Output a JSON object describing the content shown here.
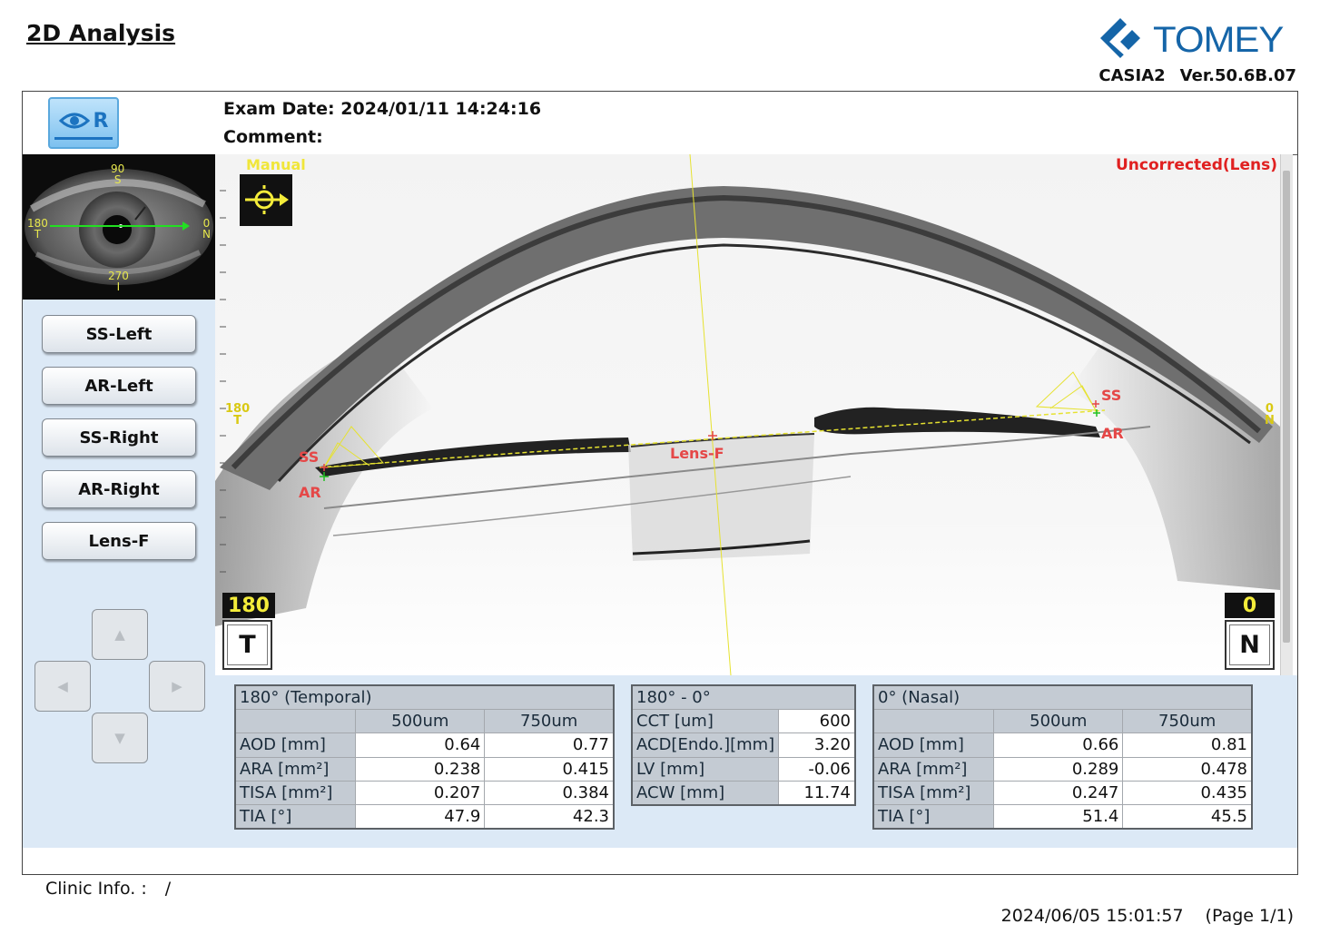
{
  "page": {
    "title": "2D Analysis",
    "brand": "TOMEY",
    "device": "CASIA2",
    "version": "Ver.50.6B.07"
  },
  "exam": {
    "eye": "R",
    "date_label": "Exam Date:",
    "date_value": "2024/01/11 14:24:16",
    "comment_label": "Comment:",
    "comment_value": ""
  },
  "fundus": {
    "top_angle": "90",
    "top_dir": "S",
    "left_angle": "180",
    "left_dir": "T",
    "right_angle": "0",
    "right_dir": "N",
    "bottom_angle": "270",
    "bottom_dir": "I"
  },
  "sidebar": {
    "buttons": [
      "SS-Left",
      "AR-Left",
      "SS-Right",
      "AR-Right",
      "Lens-F"
    ],
    "arrows": {
      "up": "▲",
      "left": "◀",
      "right": "▶",
      "down": "▼"
    }
  },
  "scan": {
    "mode_label": "Manual",
    "correction_label": "Uncorrected(Lens)",
    "left_ss": "SS",
    "left_ar": "AR",
    "right_ss": "SS",
    "right_ar": "AR",
    "lens_label": "Lens-F",
    "left_edge_angle": "180",
    "left_edge_dir": "T",
    "right_edge_angle": "0",
    "right_edge_dir": "N",
    "left_angle_box": "180",
    "left_dir_box": "T",
    "right_angle_box": "0",
    "right_dir_box": "N"
  },
  "tables": {
    "temporal": {
      "title": "180° (Temporal)",
      "cols": [
        "500um",
        "750um"
      ],
      "rows": [
        {
          "label": "AOD [mm]",
          "v500": "0.64",
          "v750": "0.77"
        },
        {
          "label": "ARA [mm²]",
          "v500": "0.238",
          "v750": "0.415"
        },
        {
          "label": "TISA [mm²]",
          "v500": "0.207",
          "v750": "0.384"
        },
        {
          "label": "TIA [°]",
          "v500": "47.9",
          "v750": "42.3"
        }
      ]
    },
    "center": {
      "title": "180° - 0°",
      "rows": [
        {
          "label": "CCT [um]",
          "value": "600"
        },
        {
          "label": "ACD[Endo.][mm]",
          "value": "3.20"
        },
        {
          "label": "LV [mm]",
          "value": "-0.06"
        },
        {
          "label": "ACW [mm]",
          "value": "11.74"
        }
      ]
    },
    "nasal": {
      "title": "0° (Nasal)",
      "cols": [
        "500um",
        "750um"
      ],
      "rows": [
        {
          "label": "AOD [mm]",
          "v500": "0.66",
          "v750": "0.81"
        },
        {
          "label": "ARA [mm²]",
          "v500": "0.289",
          "v750": "0.478"
        },
        {
          "label": "TISA [mm²]",
          "v500": "0.247",
          "v750": "0.435"
        },
        {
          "label": "TIA [°]",
          "v500": "51.4",
          "v750": "45.5"
        }
      ]
    }
  },
  "footer": {
    "clinic_label": "Clinic Info. :",
    "clinic_value": "/",
    "printed": "2024/06/05 15:01:57",
    "page": "(Page 1/1)"
  }
}
